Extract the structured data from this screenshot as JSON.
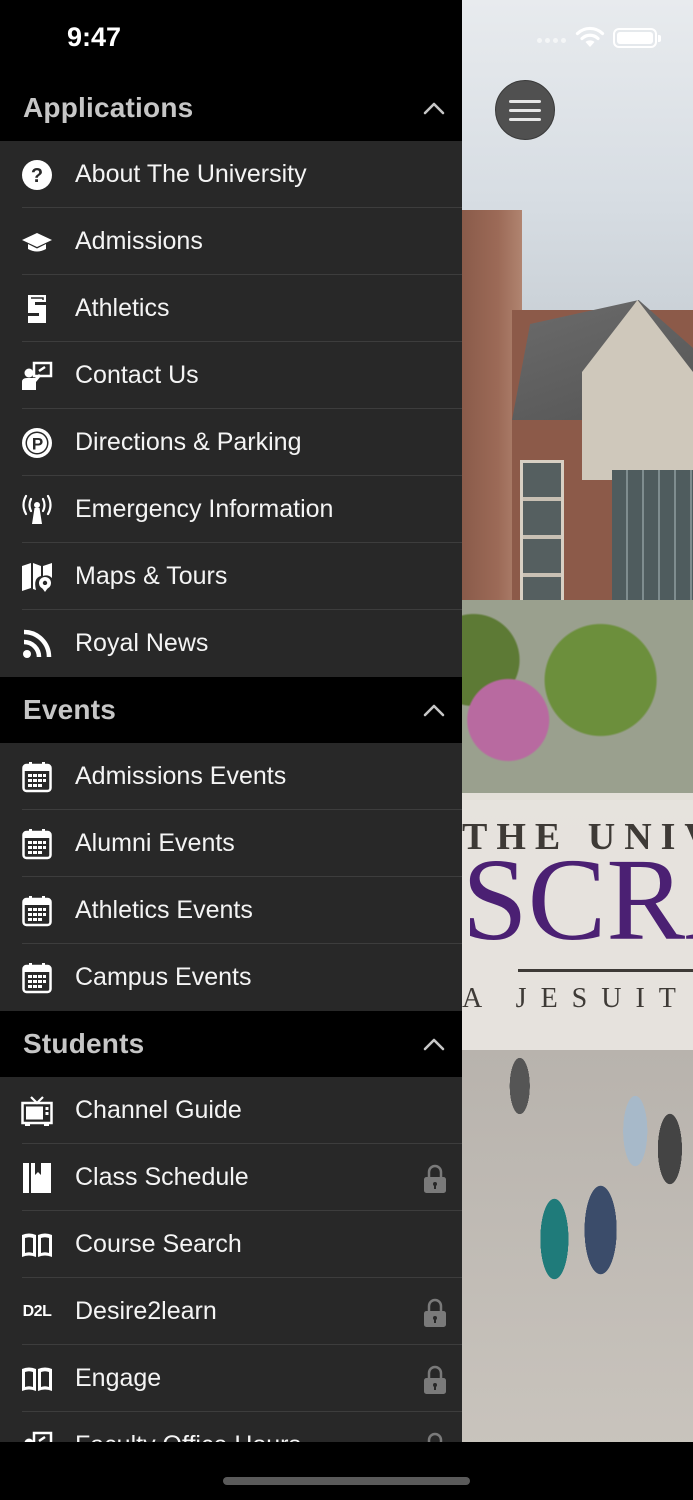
{
  "status_bar": {
    "time": "9:47"
  },
  "sections": [
    {
      "title": "Applications",
      "items": [
        {
          "label": "About The University",
          "icon": "question-circle-icon",
          "locked": false
        },
        {
          "label": "Admissions",
          "icon": "graduation-cap-icon",
          "locked": false
        },
        {
          "label": "Athletics",
          "icon": "athletics-logo-icon",
          "locked": false
        },
        {
          "label": "Contact Us",
          "icon": "presenter-icon",
          "locked": false
        },
        {
          "label": "Directions & Parking",
          "icon": "parking-icon",
          "locked": false
        },
        {
          "label": "Emergency Information",
          "icon": "broadcast-tower-icon",
          "locked": false
        },
        {
          "label": "Maps & Tours",
          "icon": "map-icon",
          "locked": false
        },
        {
          "label": "Royal News",
          "icon": "rss-icon",
          "locked": false
        }
      ]
    },
    {
      "title": "Events",
      "items": [
        {
          "label": "Admissions Events",
          "icon": "calendar-icon",
          "locked": false
        },
        {
          "label": "Alumni Events",
          "icon": "calendar-icon",
          "locked": false
        },
        {
          "label": "Athletics Events",
          "icon": "calendar-icon",
          "locked": false
        },
        {
          "label": "Campus Events",
          "icon": "calendar-icon",
          "locked": false
        }
      ]
    },
    {
      "title": "Students",
      "items": [
        {
          "label": "Channel Guide",
          "icon": "tv-icon",
          "locked": false
        },
        {
          "label": "Class Schedule",
          "icon": "schedule-book-icon",
          "locked": true
        },
        {
          "label": "Course Search",
          "icon": "open-book-icon",
          "locked": false
        },
        {
          "label": "Desire2learn",
          "icon": "d2l-icon",
          "icon_text": "D2L",
          "locked": true
        },
        {
          "label": "Engage",
          "icon": "open-book-icon",
          "locked": true
        },
        {
          "label": "Faculty Office Hours",
          "icon": "presenter-icon",
          "locked": true
        }
      ]
    }
  ],
  "background": {
    "banner_line1": "THE UNIVERSITY",
    "banner_line2": "SCRANTON",
    "banner_line3": "A JESUIT UNIVERSITY",
    "brand_color": "#4b2073"
  },
  "colors": {
    "drawer_bg": "#282828",
    "header_bg": "#000000",
    "text": "#f4f4f4",
    "header_text": "#c6c6c6"
  }
}
